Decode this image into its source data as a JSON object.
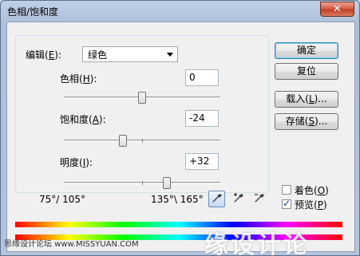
{
  "window": {
    "title": "色相/饱和度",
    "close_glyph": "✕"
  },
  "edit": {
    "label_prefix": "编辑(",
    "label_key": "E",
    "label_suffix": "):",
    "value": "绿色"
  },
  "hue": {
    "label_prefix": "色相(",
    "label_key": "H",
    "label_suffix": "):",
    "value": "0",
    "fraction": 0.5
  },
  "saturation": {
    "label_prefix": "饱和度(",
    "label_key": "A",
    "label_suffix": "):",
    "value": "-24",
    "fraction": 0.38
  },
  "lightness": {
    "label_prefix": "明度(",
    "label_key": "I",
    "label_suffix": "):",
    "value": "+32",
    "fraction": 0.66
  },
  "buttons": {
    "ok": "确定",
    "reset": "复位",
    "load_prefix": "载入(",
    "load_key": "L",
    "load_suffix": ")...",
    "save_prefix": "存储(",
    "save_key": "S",
    "save_suffix": ")..."
  },
  "options": {
    "colorize_prefix": "着色(",
    "colorize_key": "O",
    "colorize_suffix": ")",
    "colorize_checked": false,
    "preview_prefix": "预览(",
    "preview_key": "P",
    "preview_suffix": ")",
    "preview_checked": true
  },
  "range": {
    "left": "75°/ 105°",
    "right": "135°\\ 165°"
  },
  "watermark": {
    "left": "思缘设计论坛  www.MISSYUAN.COM",
    "right": "缘设计论"
  },
  "icons": [
    "eyedropper-icon",
    "eyedropper-plus-icon",
    "eyedropper-minus-icon"
  ],
  "colors": {
    "accent_border": "#3c7fb1",
    "close_red": "#c03b22",
    "checkmark": "#1f3b7a"
  }
}
